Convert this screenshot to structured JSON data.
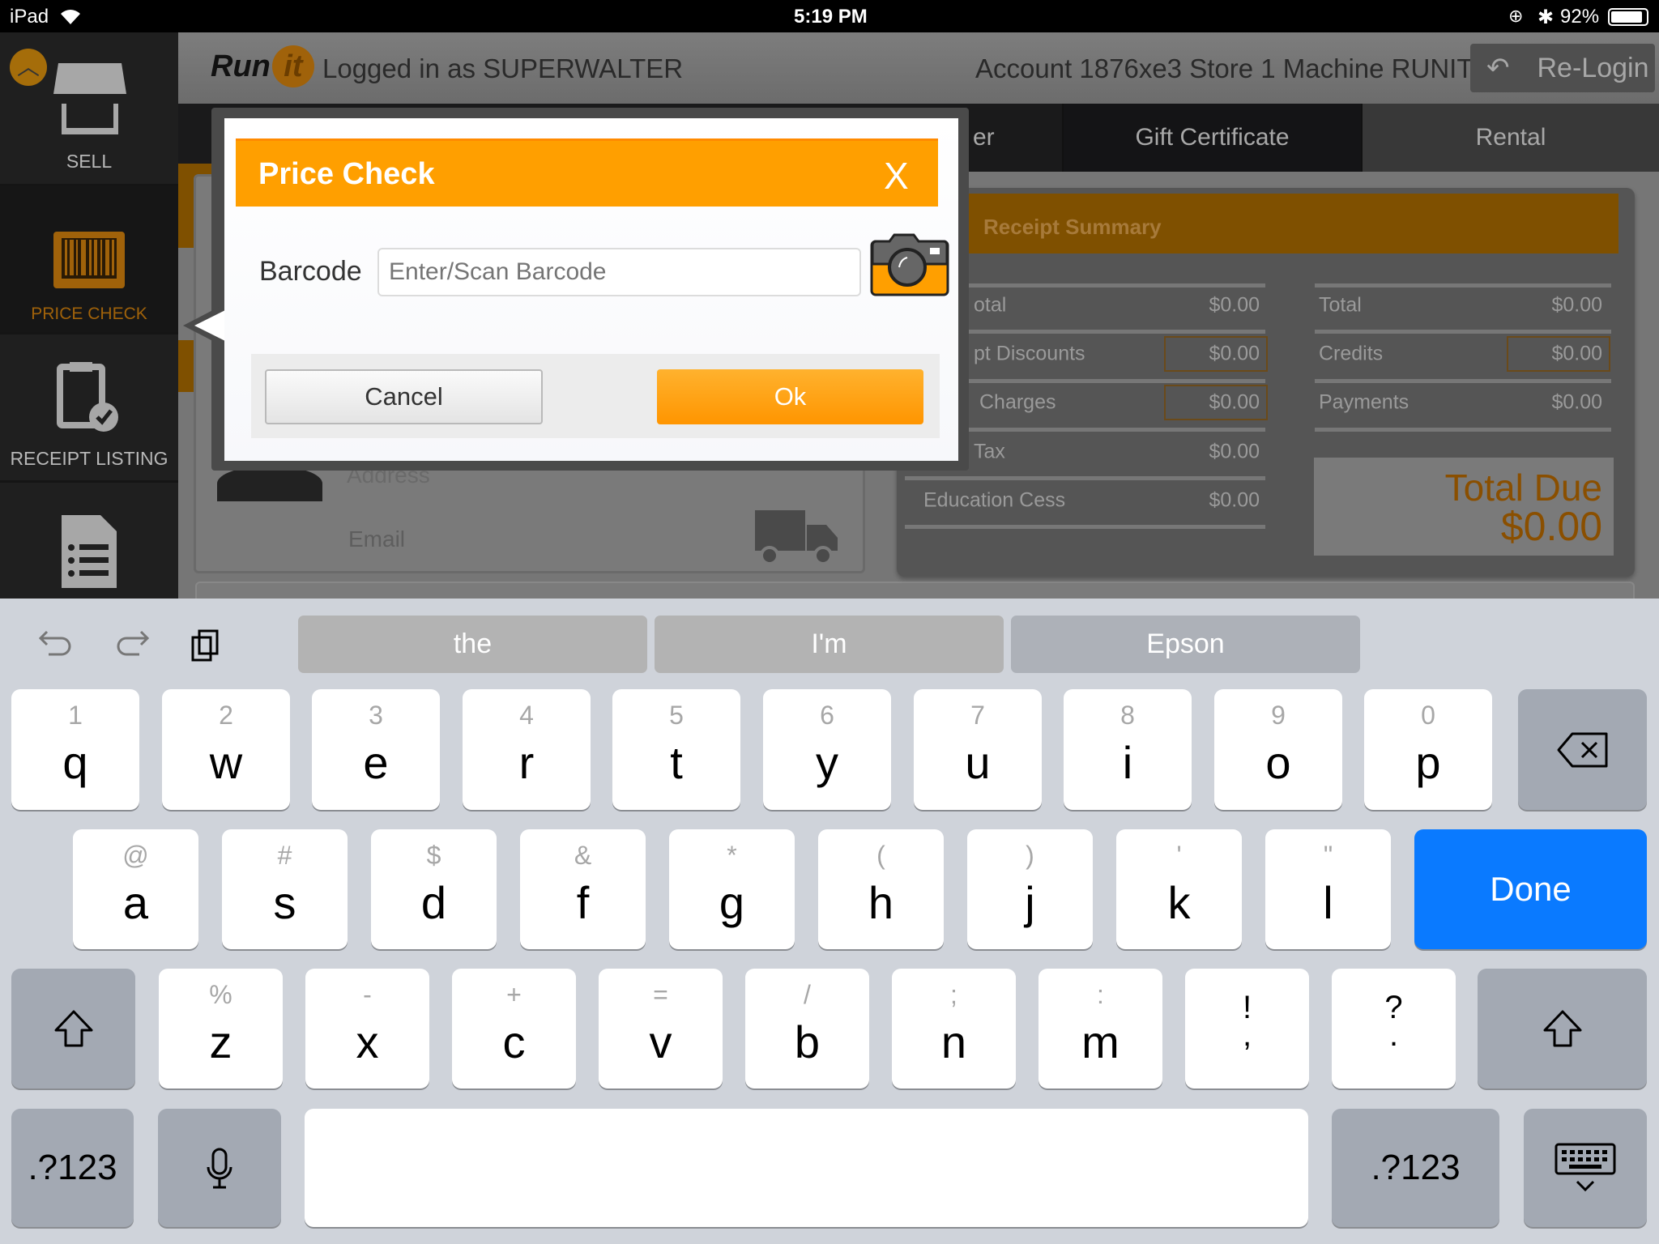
{
  "status_bar": {
    "device": "iPad",
    "time": "5:19 PM",
    "battery": "92%"
  },
  "sidebar": {
    "items": [
      {
        "label": "SELL",
        "icon": "storefront-icon"
      },
      {
        "label": "PRICE CHECK",
        "icon": "barcode-icon",
        "active": true
      },
      {
        "label": "RECEIPT LISTING",
        "icon": "clipboard-check-icon"
      },
      {
        "label": "",
        "icon": "document-list-icon"
      }
    ]
  },
  "header": {
    "logo": "Run it",
    "logged_in": "Logged in as SUPERWALTER",
    "account": "Account 1876xe3 Store 1 Machine RUNIT",
    "relogin_label": "Re-Login"
  },
  "tabs": [
    {
      "label": "er"
    },
    {
      "label": "Gift Certificate"
    },
    {
      "label": "Rental"
    }
  ],
  "customer_panel": {
    "address_placeholder": "Address",
    "email_placeholder": "Email"
  },
  "receipt_summary": {
    "title": "Receipt Summary",
    "left_rows": [
      {
        "label": "otal",
        "value": "$0.00"
      },
      {
        "label": "pt Discounts",
        "value": "$0.00"
      },
      {
        "label": "Charges",
        "value": "$0.00"
      },
      {
        "label": "Tax",
        "value": "$0.00"
      },
      {
        "label": "Education Cess",
        "value": "$0.00"
      }
    ],
    "right_rows": [
      {
        "label": "Total",
        "value": "$0.00"
      },
      {
        "label": "Credits",
        "value": "$0.00"
      },
      {
        "label": "Payments",
        "value": "$0.00"
      }
    ],
    "total_due_label": "Total Due",
    "total_due_value": "$0.00"
  },
  "modal": {
    "title": "Price Check",
    "close": "X",
    "barcode_label": "Barcode",
    "barcode_value": "",
    "barcode_placeholder": "Enter/Scan Barcode",
    "cancel_label": "Cancel",
    "ok_label": "Ok"
  },
  "colors": {
    "accent": "#FF9F00",
    "done_blue": "#0A7AFF"
  },
  "keyboard": {
    "suggestions": [
      "the",
      "I'm",
      "Epson"
    ],
    "row1": [
      [
        "q",
        "1"
      ],
      [
        "w",
        "2"
      ],
      [
        "e",
        "3"
      ],
      [
        "r",
        "4"
      ],
      [
        "t",
        "5"
      ],
      [
        "y",
        "6"
      ],
      [
        "u",
        "7"
      ],
      [
        "i",
        "8"
      ],
      [
        "o",
        "9"
      ],
      [
        "p",
        "0"
      ]
    ],
    "row2": [
      [
        "a",
        "@"
      ],
      [
        "s",
        "#"
      ],
      [
        "d",
        "$"
      ],
      [
        "f",
        "&"
      ],
      [
        "g",
        "*"
      ],
      [
        "h",
        "("
      ],
      [
        "j",
        ")"
      ],
      [
        "k",
        "'"
      ],
      [
        "l",
        "\""
      ]
    ],
    "row3": [
      [
        "z",
        "%"
      ],
      [
        "x",
        "-"
      ],
      [
        "c",
        "+"
      ],
      [
        "v",
        "="
      ],
      [
        "b",
        "/"
      ],
      [
        "n",
        ";"
      ],
      [
        "m",
        ":"
      ],
      [
        ",",
        "!"
      ],
      [
        ".",
        "?"
      ]
    ],
    "done_label": "Done",
    "numbers_label": ".?123"
  }
}
